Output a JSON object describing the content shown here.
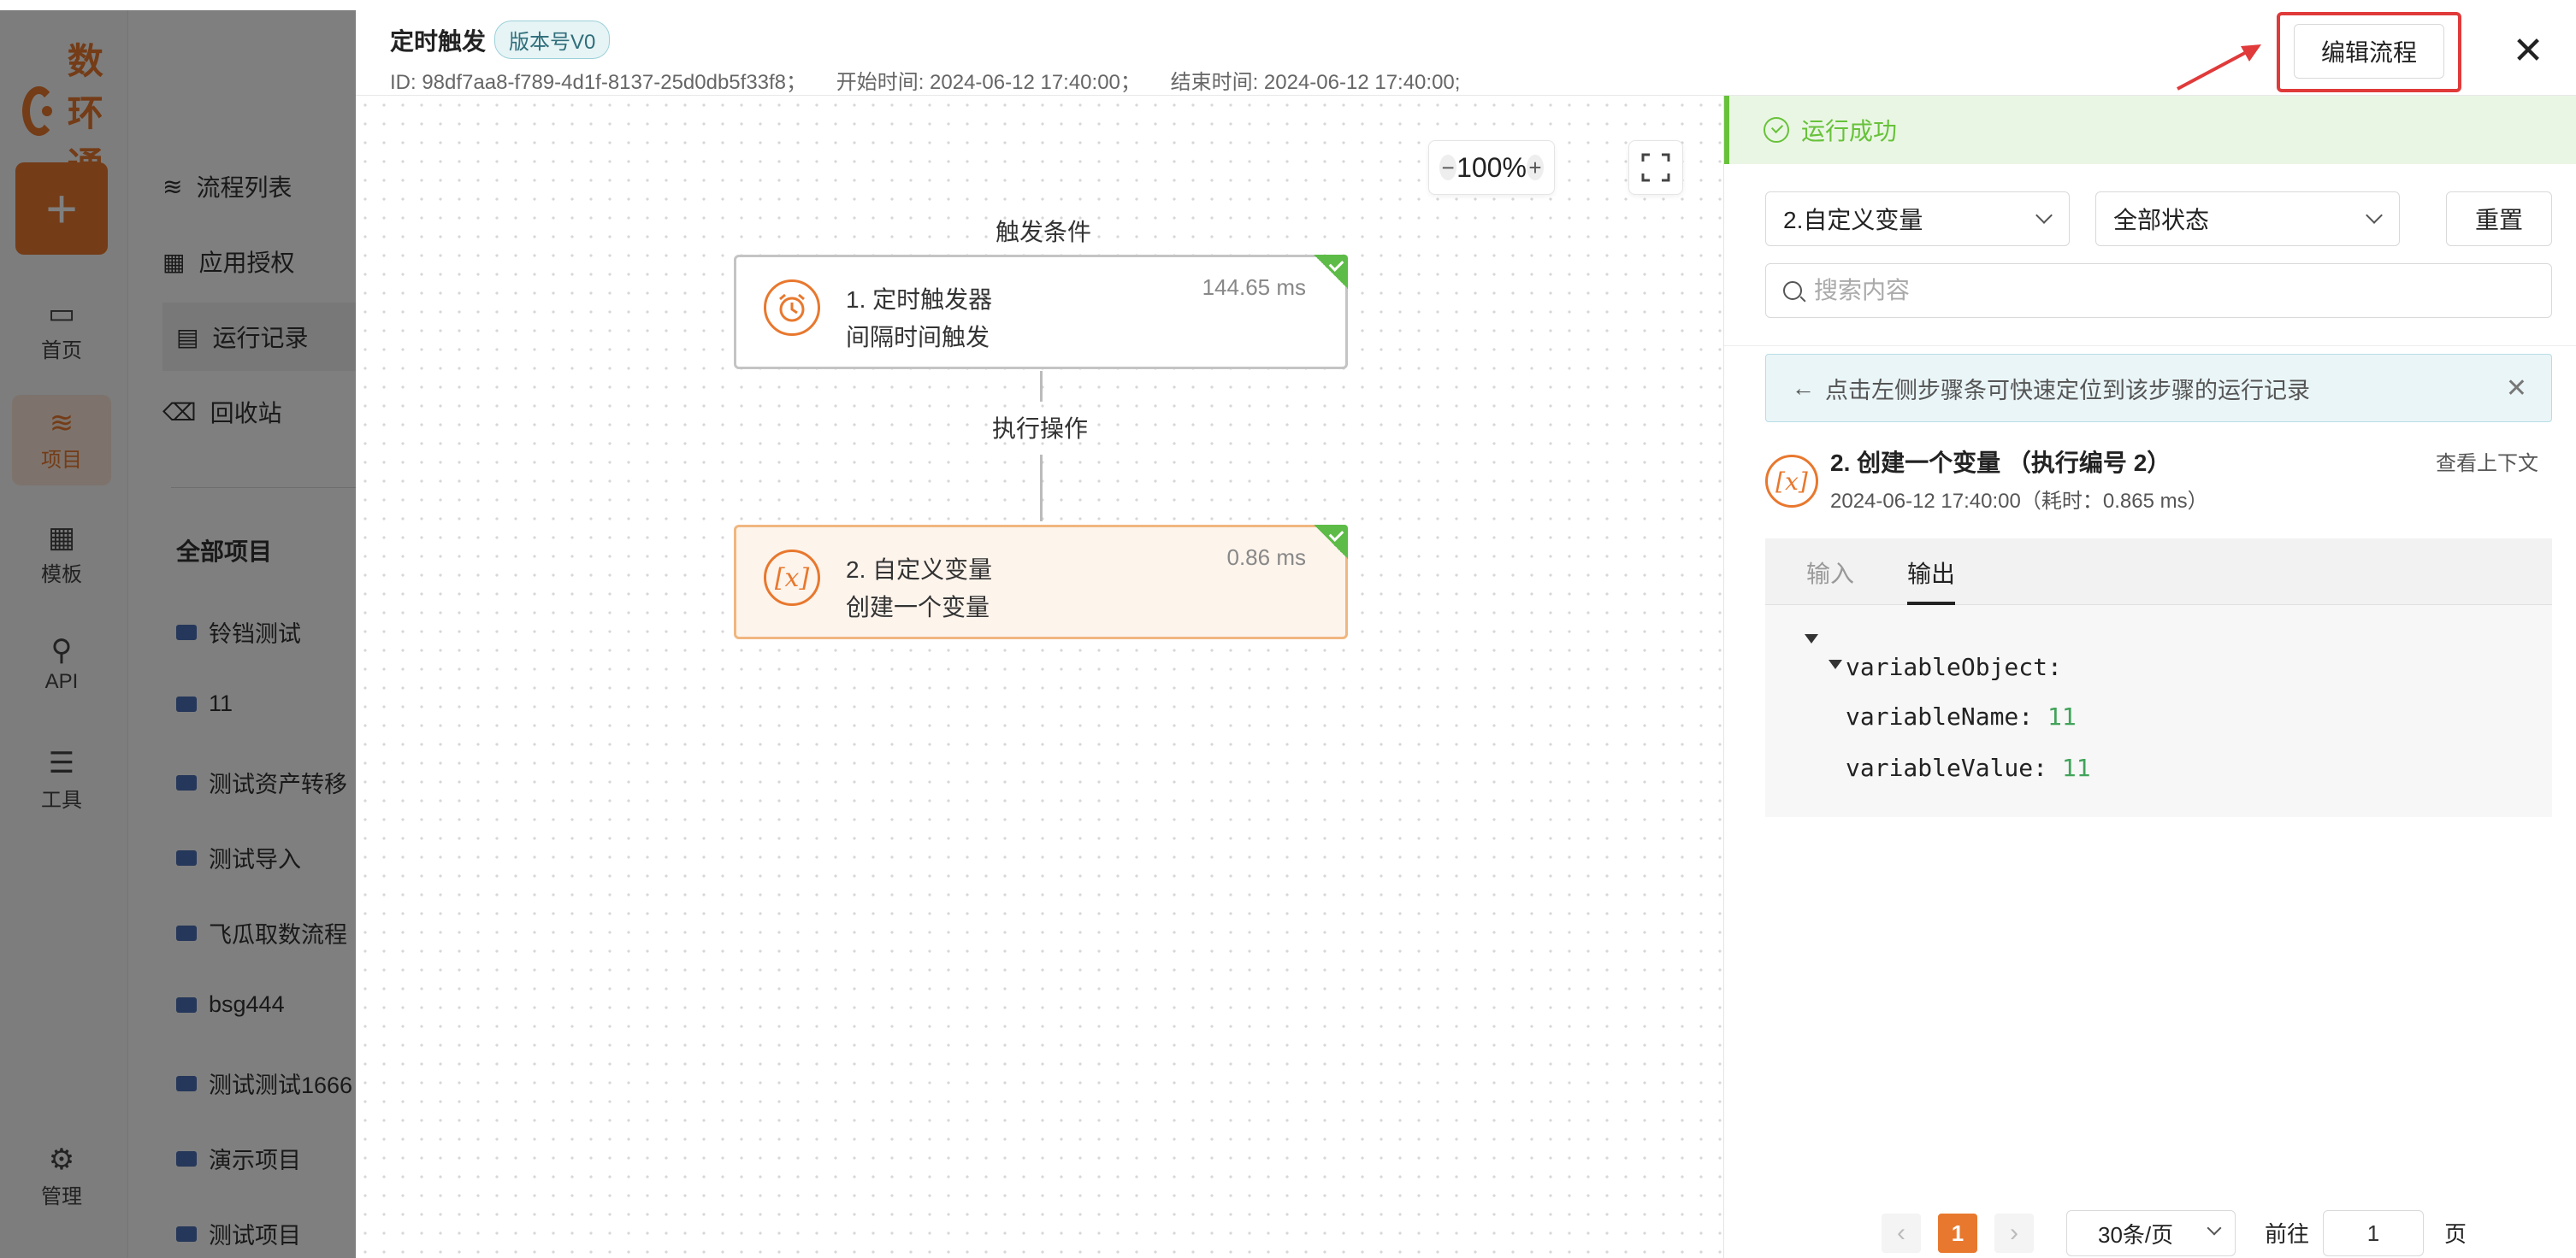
{
  "background": {
    "logo_text": "数环通",
    "rail": [
      {
        "label": "首页",
        "icon": "monitor-icon"
      },
      {
        "label": "项目",
        "icon": "layers-icon",
        "active": true
      },
      {
        "label": "模板",
        "icon": "grid-icon"
      },
      {
        "label": "API",
        "icon": "api-icon"
      },
      {
        "label": "工具",
        "icon": "tools-icon"
      },
      {
        "label": "管理",
        "icon": "gear-icon"
      }
    ],
    "menu": [
      "流程列表",
      "应用授权",
      "运行记录",
      "回收站"
    ],
    "projects_title": "全部项目",
    "projects": [
      "铃铛测试",
      "11",
      "测试资产转移",
      "测试导入",
      "飞瓜取数流程",
      "bsg444",
      "测试测试1666",
      "演示项目",
      "测试项目"
    ]
  },
  "drawer": {
    "title": "定时触发",
    "version": "版本号V0",
    "meta": {
      "id": "ID: 98df7aa8-f789-4d1f-8137-25d0db5f33f8；",
      "start": "开始时间: 2024-06-12 17:40:00；",
      "end": "结束时间: 2024-06-12 17:40:00;"
    },
    "edit_button": "编辑流程",
    "close_icon": "close-icon"
  },
  "canvas": {
    "zoom": "100%",
    "trigger_label": "触发条件",
    "action_label": "执行操作",
    "nodes": [
      {
        "line1": "1. 定时触发器",
        "line2": "间隔时间触发",
        "time": "144.65 ms",
        "icon": "alarm-clock-icon"
      },
      {
        "line1": "2. 自定义变量",
        "line2": "创建一个变量",
        "time": "0.86 ms",
        "icon": "variable-icon"
      }
    ]
  },
  "panel": {
    "status": "运行成功",
    "step_select": "2.自定义变量",
    "status_select": "全部状态",
    "reset": "重置",
    "search_placeholder": "搜索内容",
    "tip": "点击左侧步骤条可快速定位到该步骤的运行记录",
    "step": {
      "title": "2. 创建一个变量 （执行编号 2）",
      "subtitle": "2024-06-12 17:40:00（耗时：0.865 ms）",
      "context_link": "查看上下文"
    },
    "tabs": [
      "输入",
      "输出"
    ],
    "active_tab": "输出",
    "output": {
      "object_key": "variableObject:",
      "name_key": "variableName:",
      "name_value": "11",
      "value_key": "variableValue:",
      "value_value": "11"
    },
    "pager": {
      "current": "1",
      "page_size": "30条/页",
      "goto_label": "前往",
      "goto_value": "1",
      "unit": "页"
    }
  },
  "colors": {
    "brand": "#e8782e",
    "success": "#67c23a",
    "highlight": "#e03a3a"
  }
}
